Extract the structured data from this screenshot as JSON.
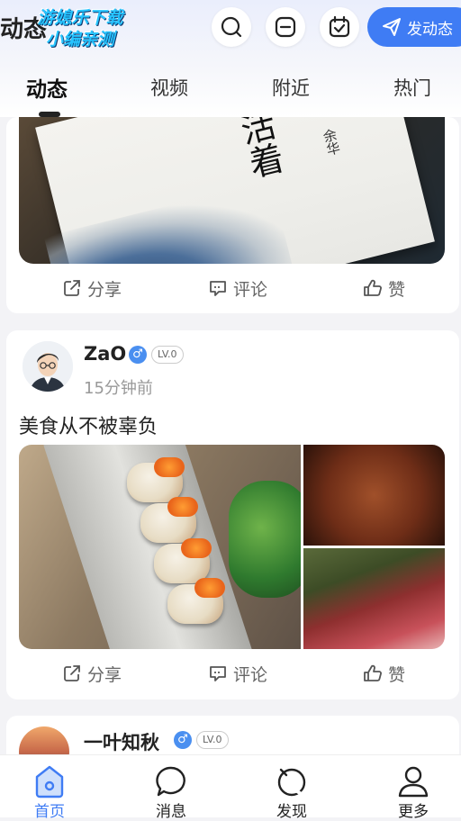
{
  "header": {
    "title": "动态",
    "watermark_line1": "游媳乐下载",
    "watermark_line2": "小编亲测",
    "post_button_label": "发动态",
    "icons": [
      "search-icon",
      "scan-icon",
      "calendar-check-icon",
      "send-icon"
    ]
  },
  "tabs": [
    {
      "label": "动态",
      "active": true
    },
    {
      "label": "视频",
      "active": false
    },
    {
      "label": "附近",
      "active": false
    },
    {
      "label": "热门",
      "active": false
    }
  ],
  "posts": [
    {
      "image_text_title": "活着",
      "image_text_author": "余华",
      "actions": {
        "share": "分享",
        "comment": "评论",
        "like": "赞"
      }
    },
    {
      "username": "ZaO",
      "gender": "♂",
      "level": "LV.0",
      "time": "15分钟前",
      "text": "美食从不被辜负",
      "actions": {
        "share": "分享",
        "comment": "评论",
        "like": "赞"
      }
    },
    {
      "username": "一叶知秋",
      "gender": "♂",
      "level": "LV.0"
    }
  ],
  "bottom_nav": [
    {
      "label": "首页",
      "icon": "home-icon",
      "active": true
    },
    {
      "label": "消息",
      "icon": "message-icon",
      "active": false
    },
    {
      "label": "发现",
      "icon": "discover-icon",
      "active": false
    },
    {
      "label": "更多",
      "icon": "profile-icon",
      "active": false
    }
  ],
  "colors": {
    "accent": "#3f7cf4",
    "background": "#f3f3f6",
    "gender_badge": "#4a8ff0"
  }
}
